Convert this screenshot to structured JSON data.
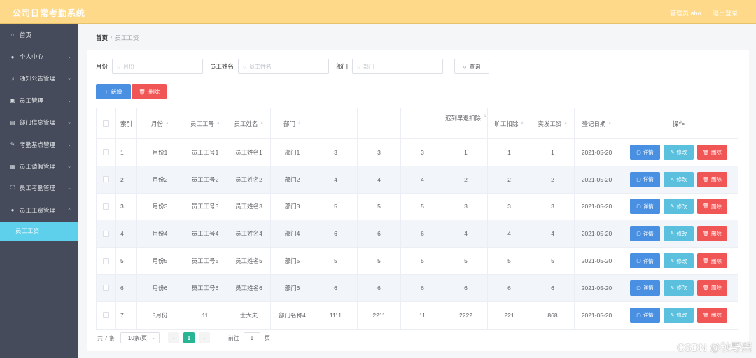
{
  "header": {
    "title": "公司日常考勤系统",
    "user": "管理员 abo",
    "logout": "退出登录",
    "bg_color": "#ffd98a"
  },
  "sidebar": {
    "items": [
      {
        "label": "首页",
        "icon": "home-icon",
        "glyph": "⌂"
      },
      {
        "label": "个人中心",
        "icon": "user-icon",
        "glyph": "●"
      },
      {
        "label": "通知公告管理",
        "icon": "bell-icon",
        "glyph": "♫"
      },
      {
        "label": "员工管理",
        "icon": "briefcase-icon",
        "glyph": "▣"
      },
      {
        "label": "部门信息管理",
        "icon": "document-icon",
        "glyph": "▤"
      },
      {
        "label": "考勤基点管理",
        "icon": "edit-icon",
        "glyph": "✎"
      },
      {
        "label": "员工请假管理",
        "icon": "calendar-icon",
        "glyph": "▦"
      },
      {
        "label": "员工考勤管理",
        "icon": "scan-icon",
        "glyph": "⛶"
      },
      {
        "label": "员工工资管理",
        "icon": "person-icon",
        "glyph": "●"
      }
    ],
    "sub_item": "员工工资",
    "active_color": "#5ed0ec"
  },
  "breadcrumb": {
    "home": "首页",
    "sep": "/",
    "current": "员工工资"
  },
  "search": {
    "month_label": "月份",
    "month_placeholder": "月份",
    "name_label": "员工姓名",
    "name_placeholder": "员工姓名",
    "dept_label": "部门",
    "dept_placeholder": "部门",
    "query": "查询"
  },
  "actions": {
    "add": "新增",
    "delete": "删除"
  },
  "table": {
    "headers": {
      "index": "索引",
      "month": "月份",
      "emp_no": "员工工号",
      "emp_name": "员工姓名",
      "dept": "部门",
      "late": "迟到早退扣除",
      "absent": "旷工扣除",
      "salary": "实发工资",
      "date": "登记日期",
      "ops": "操作"
    },
    "rows": [
      {
        "idx": "1",
        "month": "月份1",
        "no": "员工工号1",
        "name": "员工姓名1",
        "dept": "部门1",
        "a": "3",
        "b": "3",
        "c": "3",
        "late": "1",
        "absent": "1",
        "salary": "1",
        "date": "2021-05-20"
      },
      {
        "idx": "2",
        "month": "月份2",
        "no": "员工工号2",
        "name": "员工姓名2",
        "dept": "部门2",
        "a": "4",
        "b": "4",
        "c": "4",
        "late": "2",
        "absent": "2",
        "salary": "2",
        "date": "2021-05-20"
      },
      {
        "idx": "3",
        "month": "月份3",
        "no": "员工工号3",
        "name": "员工姓名3",
        "dept": "部门3",
        "a": "5",
        "b": "5",
        "c": "5",
        "late": "3",
        "absent": "3",
        "salary": "3",
        "date": "2021-05-20"
      },
      {
        "idx": "4",
        "month": "月份4",
        "no": "员工工号4",
        "name": "员工姓名4",
        "dept": "部门4",
        "a": "6",
        "b": "6",
        "c": "6",
        "late": "4",
        "absent": "4",
        "salary": "4",
        "date": "2021-05-20"
      },
      {
        "idx": "5",
        "month": "月份5",
        "no": "员工工号5",
        "name": "员工姓名5",
        "dept": "部门5",
        "a": "5",
        "b": "5",
        "c": "5",
        "late": "5",
        "absent": "5",
        "salary": "5",
        "date": "2021-05-20"
      },
      {
        "idx": "6",
        "month": "月份6",
        "no": "员工工号6",
        "name": "员工姓名6",
        "dept": "部门6",
        "a": "6",
        "b": "6",
        "c": "6",
        "late": "6",
        "absent": "6",
        "salary": "6",
        "date": "2021-05-20"
      },
      {
        "idx": "7",
        "month": "8月份",
        "no": "11",
        "name": "士大夫",
        "dept": "部门名称4",
        "a": "1111",
        "b": "2211",
        "c": "11",
        "late": "2222",
        "absent": "221",
        "salary": "868",
        "date": "2021-05-20"
      }
    ],
    "op_detail": "详情",
    "op_edit": "修改",
    "op_delete": "删除"
  },
  "pager": {
    "total": "共 7 条",
    "size": "10条/页",
    "page": "1",
    "goto": "前往",
    "goto_value": "1",
    "page_suffix": "页"
  },
  "watermark": "CSDN @秋野酱"
}
